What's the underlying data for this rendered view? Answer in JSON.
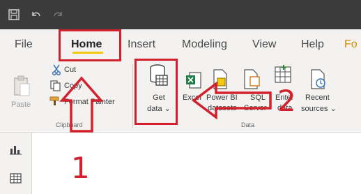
{
  "quick_access": {
    "save_icon": "save-icon",
    "undo_icon": "undo-icon",
    "redo_icon": "redo-icon"
  },
  "tabs": [
    {
      "label": "File"
    },
    {
      "label": "Home"
    },
    {
      "label": "Insert"
    },
    {
      "label": "Modeling"
    },
    {
      "label": "View"
    },
    {
      "label": "Help"
    },
    {
      "label": "Fo"
    }
  ],
  "clipboard": {
    "paste": "Paste",
    "cut": "Cut",
    "copy": "Copy",
    "format_painter": "Format Painter",
    "group_label": "Clipboard"
  },
  "data": {
    "get_data_1": "Get",
    "get_data_2": "data ⌄",
    "excel": "Excel",
    "powerbi_1": "Power BI",
    "powerbi_2": "datasets",
    "sql_1": "SQL",
    "sql_2": "Server",
    "enter_1": "Enter",
    "enter_2": "data",
    "recent_1": "Recent",
    "recent_2": "sources ⌄",
    "group_label": "Data"
  },
  "annotations": {
    "step1": "1",
    "step2": "2"
  },
  "colors": {
    "title_bar": "#3b3b3b",
    "ribbon_bg": "#f3f2f1",
    "accent_underline": "#f2c811",
    "annotation_red": "#d2202c"
  }
}
